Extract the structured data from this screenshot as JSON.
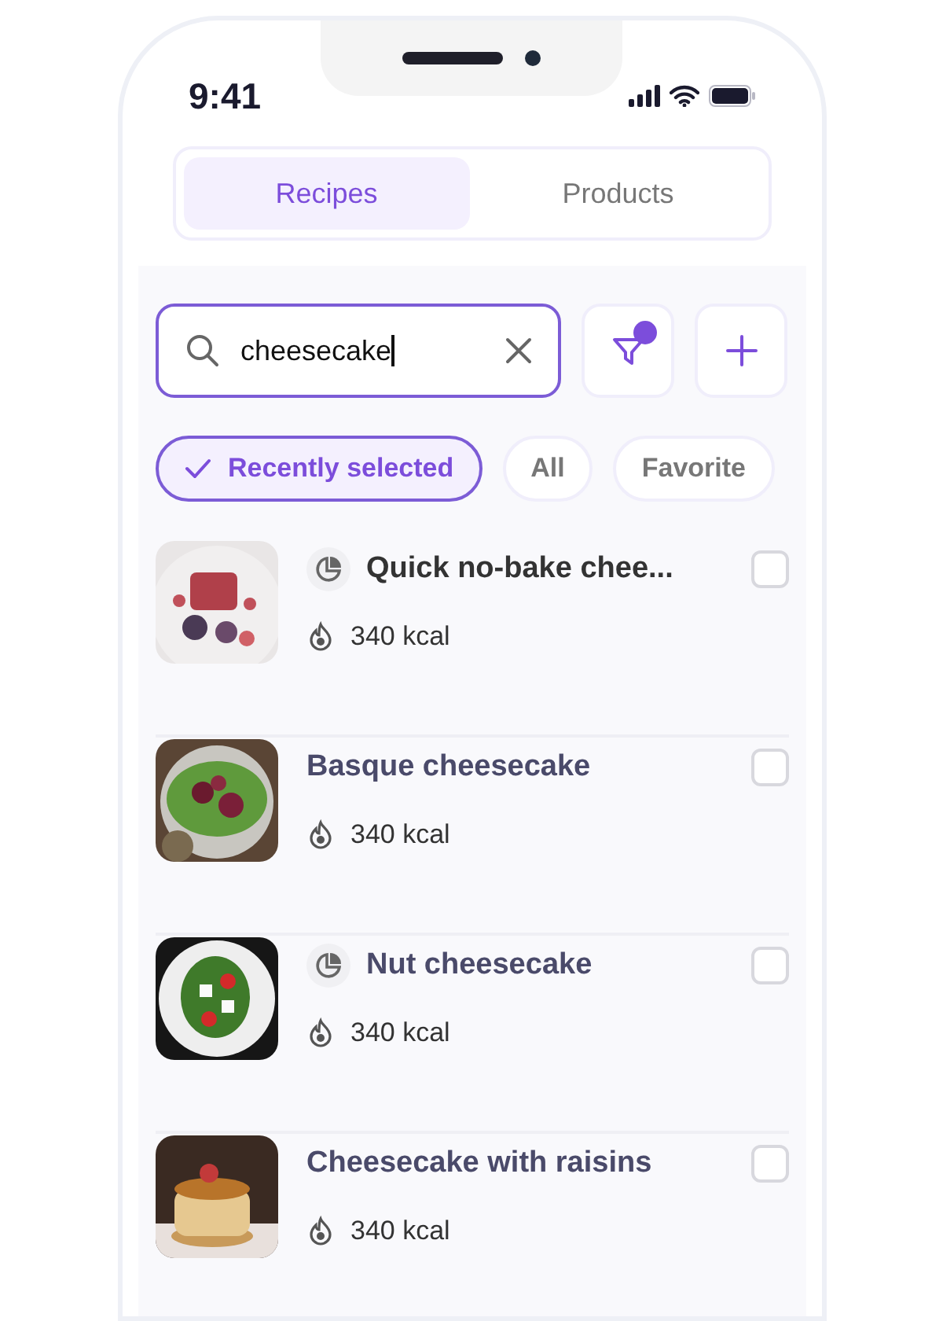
{
  "status_bar": {
    "time": "9:41"
  },
  "tabs": [
    {
      "label": "Recipes",
      "selected": true
    },
    {
      "label": "Products",
      "selected": false
    }
  ],
  "search": {
    "value": "cheesecake"
  },
  "filter": {
    "active": true
  },
  "chips": [
    {
      "label": "Recently selected",
      "selected": true
    },
    {
      "label": "All",
      "selected": false
    },
    {
      "label": "Favorite",
      "selected": false
    }
  ],
  "recipes": [
    {
      "title": "Quick no-bake chee...",
      "calories": "340 kcal",
      "portion_icon": true,
      "checked": false
    },
    {
      "title": "Basque cheesecake",
      "calories": "340 kcal",
      "portion_icon": false,
      "checked": false
    },
    {
      "title": "Nut cheesecake",
      "calories": "340 kcal",
      "portion_icon": true,
      "checked": false
    },
    {
      "title": "Cheesecake with raisins",
      "calories": "340 kcal",
      "portion_icon": false,
      "checked": false
    }
  ]
}
